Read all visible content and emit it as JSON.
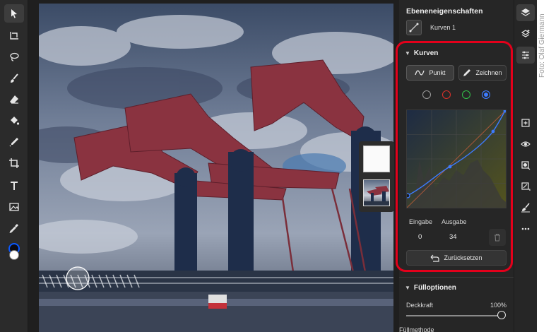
{
  "panel": {
    "title": "Ebeneneigenschaften",
    "layer_name": "Kurven 1"
  },
  "curves": {
    "heading": "Kurven",
    "point_label": "Punkt",
    "draw_label": "Zeichnen",
    "channels": [
      {
        "name": "rgb",
        "color": "#9a9a9a"
      },
      {
        "name": "red",
        "color": "#e0312a"
      },
      {
        "name": "green",
        "color": "#32c24a"
      },
      {
        "name": "blue",
        "color": "#3d7bff",
        "selected": true
      }
    ],
    "input_label": "Eingabe",
    "output_label": "Ausgabe",
    "input_value": "0",
    "output_value": "34",
    "reset_label": "Zurücksetzen"
  },
  "fill_options": {
    "heading": "Fülloptionen",
    "opacity_label": "Deckkraft",
    "opacity_value": "100%",
    "opacity_level": 1.0,
    "blend_label": "Füllmethode"
  },
  "credit": "Foto: Olaf Giermann",
  "colors": {
    "highlight": "#e3001b",
    "accent": "#3d7bff",
    "bridge": "#8a3340"
  },
  "icons": {
    "tools": [
      "select-arrow-icon",
      "transform-icon",
      "lasso-icon",
      "brush-icon",
      "eraser-icon",
      "paint-bucket-icon",
      "healing-brush-icon",
      "crop-icon",
      "type-icon",
      "image-icon",
      "eyedropper-icon"
    ],
    "right": [
      "layers-icon",
      "layer-stack-icon",
      "adjustments-icon",
      "add-layer-icon",
      "visibility-icon",
      "mask-icon",
      "mask-link-icon",
      "brush-mask-icon",
      "more-icon"
    ]
  }
}
